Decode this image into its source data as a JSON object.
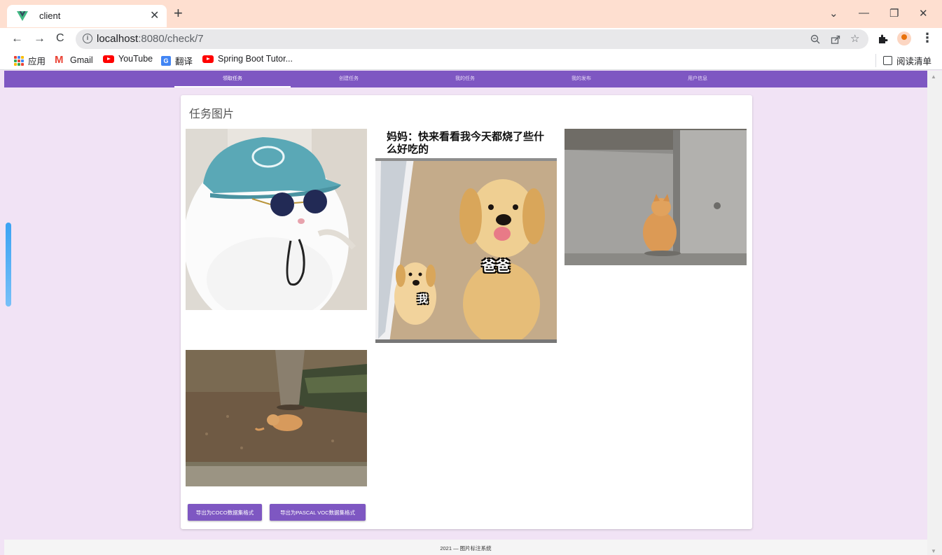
{
  "browser": {
    "tab_title": "client",
    "tab_close": "✕",
    "new_tab": "+",
    "url_host": "localhost",
    "url_rest": ":8080/check/7",
    "window_minimize": "—",
    "window_restore": "❐",
    "window_close": "✕",
    "window_dropdown": "⌄",
    "back": "←",
    "forward": "→",
    "reload": "C",
    "bookmarks": [
      {
        "label": "应用",
        "icon": "apps-grid-icon"
      },
      {
        "label": "Gmail",
        "icon": "gmail-icon"
      },
      {
        "label": "YouTube",
        "icon": "youtube-icon"
      },
      {
        "label": "翻译",
        "icon": "translate-icon"
      },
      {
        "label": "Spring Boot Tutor...",
        "icon": "youtube-icon"
      }
    ],
    "reading_list": "阅读清单"
  },
  "app": {
    "nav": [
      {
        "label": "领取任务",
        "active": true
      },
      {
        "label": "创建任务",
        "active": false
      },
      {
        "label": "我的任务",
        "active": false
      },
      {
        "label": "我的发布",
        "active": false
      },
      {
        "label": "用户信息",
        "active": false
      }
    ],
    "card_title": "任务图片",
    "images": [
      {
        "name": "cat-with-cap-and-sunglasses"
      },
      {
        "name": "dogs-meme",
        "caption": "妈妈：快来看看我今天都烧了些什么好吃的",
        "label_big": "爸爸",
        "label_small": "我"
      },
      {
        "name": "orange-cat-by-wall"
      },
      {
        "name": "cat-under-tree"
      }
    ],
    "buttons": {
      "export_coco": "导出为COCO数据集格式",
      "export_voc": "导出为PASCAL VOC数据集格式"
    },
    "footer": "2021 — 图片标注系统"
  },
  "colors": {
    "accent": "#7e57c2",
    "page_bg": "#f1e3f5",
    "tabbar_bg": "#fedfd0"
  }
}
